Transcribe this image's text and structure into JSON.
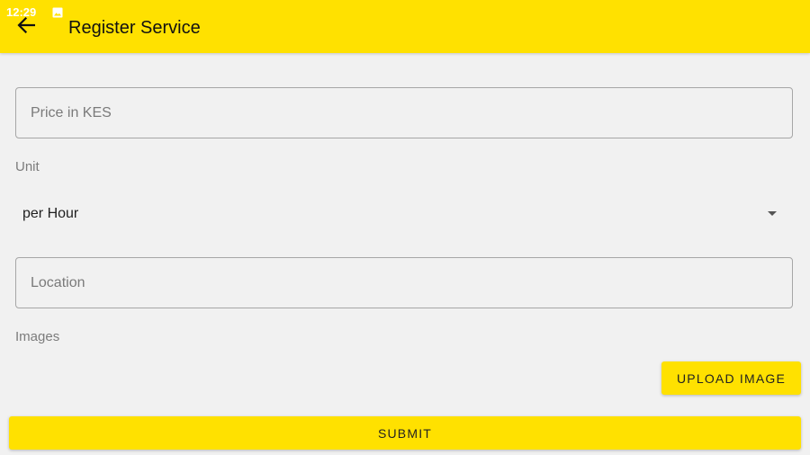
{
  "status_bar": {
    "time": "12:29",
    "notification_icon": "image-icon"
  },
  "app_bar": {
    "back_icon": "arrow-left-icon",
    "title": "Register Service",
    "background_color": "#ffe100"
  },
  "form": {
    "price_field": {
      "placeholder": "Price in KES",
      "value": ""
    },
    "unit": {
      "label": "Unit",
      "selected": "per Hour",
      "dropdown_icon": "caret-down-icon"
    },
    "location_field": {
      "placeholder": "Location",
      "value": ""
    },
    "images": {
      "label": "Images",
      "upload_label": "UPLOAD IMAGE"
    },
    "submit_label": "SUBMIT"
  }
}
